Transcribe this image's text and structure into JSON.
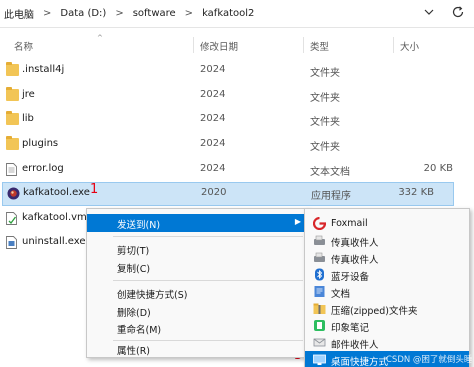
{
  "breadcrumb": {
    "items": [
      "此电脑",
      "Data (D:)",
      "software",
      "kafkatool2"
    ],
    "separator": ">"
  },
  "columns": {
    "name": "名称",
    "date": "修改日期",
    "type": "类型",
    "size": "大小"
  },
  "files": [
    {
      "name": ".install4j",
      "date": "2024",
      "type": "文件夹",
      "size": "",
      "icon": "folder-icon"
    },
    {
      "name": "jre",
      "date": "2024",
      "type": "文件夹",
      "size": "",
      "icon": "folder-icon"
    },
    {
      "name": "lib",
      "date": "2024",
      "type": "文件夹",
      "size": "",
      "icon": "folder-icon"
    },
    {
      "name": "plugins",
      "date": "2024",
      "type": "文件夹",
      "size": "",
      "icon": "folder-icon"
    },
    {
      "name": "error.log",
      "date": "2024",
      "type": "文本文档",
      "size": "20 KB",
      "icon": "text-file-icon"
    },
    {
      "name": "kafkatool.exe",
      "date": "2020",
      "type": "应用程序",
      "size": "332 KB",
      "icon": "app-icon"
    },
    {
      "name": "kafkatool.vmop",
      "date": "",
      "type": "",
      "size": "",
      "icon": "file-icon"
    },
    {
      "name": "uninstall.exe",
      "date": "",
      "type": "",
      "size": "",
      "icon": "app-icon"
    }
  ],
  "annotations": [
    "1",
    "2",
    "3"
  ],
  "context_menu": {
    "send_to": "发送到(N)",
    "cut": "剪切(T)",
    "copy": "复制(C)",
    "create_shortcut": "创建快捷方式(S)",
    "delete": "删除(D)",
    "rename": "重命名(M)",
    "properties": "属性(R)"
  },
  "send_to_menu": [
    {
      "label": "Foxmail",
      "icon": "foxmail-icon"
    },
    {
      "label": "传真收件人",
      "icon": "fax-icon"
    },
    {
      "label": "传真收件人",
      "icon": "fax-icon"
    },
    {
      "label": "蓝牙设备",
      "icon": "bluetooth-icon"
    },
    {
      "label": "文档",
      "icon": "documents-icon"
    },
    {
      "label": "压缩(zipped)文件夹",
      "icon": "zip-folder-icon"
    },
    {
      "label": "印象笔记",
      "icon": "evernote-icon"
    },
    {
      "label": "邮件收件人",
      "icon": "mail-icon"
    },
    {
      "label": "桌面快捷方式",
      "icon": "desktop-icon"
    }
  ],
  "watermark": "CSDN @困了就倒头睡",
  "colors": {
    "selection": "#cce4f7",
    "menu_highlight": "#0078d4",
    "annotation": "#e60012",
    "folder": "#f2c556"
  }
}
